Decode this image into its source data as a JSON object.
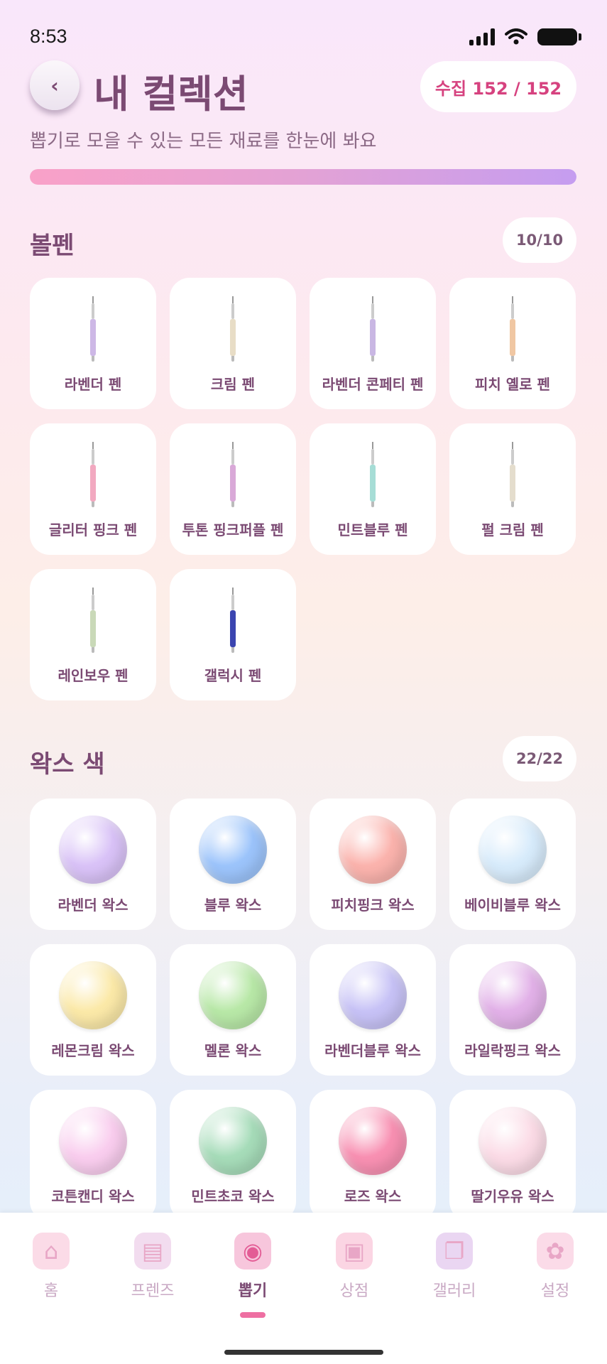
{
  "status_bar": {
    "time": "8:53"
  },
  "header": {
    "back_icon": "chevron-left-icon",
    "title": "내 컬렉션",
    "collect_label": "수집 152 / 152",
    "subtitle": "뽑기로 모을 수 있는 모든 재료를 한눈에 봐요",
    "progress": 1.0
  },
  "sections": [
    {
      "title": "볼펜",
      "count": "10/10",
      "items": [
        {
          "label": "라벤더 펜",
          "color": "#cdb8e6"
        },
        {
          "label": "크림 펜",
          "color": "#e8ddc6"
        },
        {
          "label": "라벤더 콘페티 펜",
          "color": "#c9b7e3"
        },
        {
          "label": "피치 옐로 펜",
          "color": "#f0c7a3"
        },
        {
          "label": "글리터 핑크 펜",
          "color": "#f2a9c0"
        },
        {
          "label": "투톤 핑크퍼플 펜",
          "color": "#d9a9d8"
        },
        {
          "label": "민트블루 펜",
          "color": "#a6ddd6"
        },
        {
          "label": "펄 크림 펜",
          "color": "#e4ddcd"
        },
        {
          "label": "레인보우 펜",
          "color": "#c9d9b8"
        },
        {
          "label": "갤럭시 펜",
          "color": "#3b45b0"
        }
      ]
    },
    {
      "title": "왁스 색",
      "count": "22/22",
      "items": [
        {
          "label": "라벤더 왁스",
          "color": "#d9c2f7"
        },
        {
          "label": "블루 왁스",
          "color": "#9cc4fb"
        },
        {
          "label": "피치핑크 왁스",
          "color": "#fbb3ad"
        },
        {
          "label": "베이비블루 왁스",
          "color": "#d7ebfb"
        },
        {
          "label": "레몬크림 왁스",
          "color": "#fbe9a8"
        },
        {
          "label": "멜론 왁스",
          "color": "#b8e8a7"
        },
        {
          "label": "라벤더블루 왁스",
          "color": "#c7c2f6"
        },
        {
          "label": "라일락핑크 왁스",
          "color": "#e2b1e8"
        },
        {
          "label": "코튼캔디 왁스",
          "color": "#f9cdee"
        },
        {
          "label": "민트초코 왁스",
          "color": "#a6dcb9"
        },
        {
          "label": "로즈 왁스",
          "color": "#f890b2"
        },
        {
          "label": "딸기우유 왁스",
          "color": "#fbdbe6"
        }
      ]
    }
  ],
  "nav": [
    {
      "label": "홈",
      "icon": "house-icon",
      "active": false
    },
    {
      "label": "프렌즈",
      "icon": "book-icon",
      "active": false
    },
    {
      "label": "뽑기",
      "icon": "gacha-machine-icon",
      "active": true
    },
    {
      "label": "상점",
      "icon": "shopping-bag-icon",
      "active": false
    },
    {
      "label": "갤러리",
      "icon": "album-icon",
      "active": false
    },
    {
      "label": "설정",
      "icon": "gear-icon",
      "active": false
    }
  ]
}
